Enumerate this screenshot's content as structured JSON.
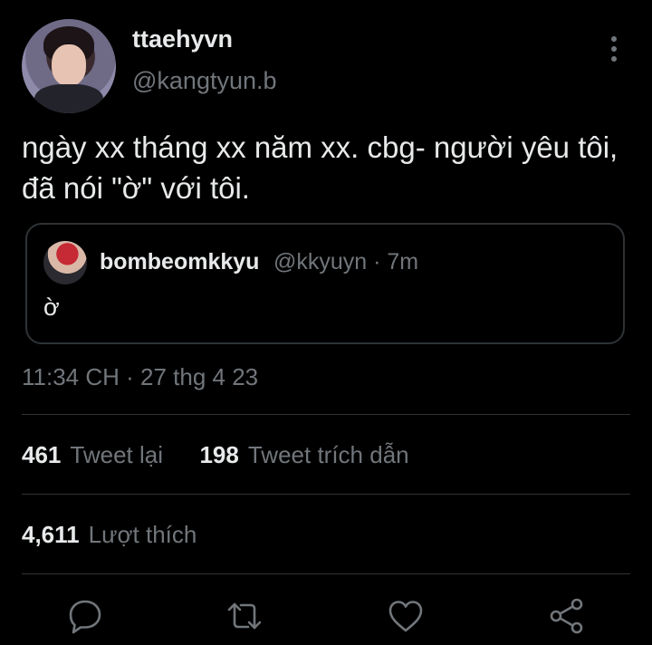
{
  "author": {
    "display_name": "ttaehyvn",
    "handle": "@kangtyun.b"
  },
  "tweet": {
    "text": "ngày xx tháng xx năm xx. cbg- người yêu tôi, đã nói \"ờ\" với tôi.",
    "timestamp": "11:34 CH · 27 thg 4 23"
  },
  "quoted_tweet": {
    "display_name": "bombeomkkyu",
    "handle_time": "@kkyuyn · 7m",
    "text": "ờ"
  },
  "stats": {
    "retweets_count": "461",
    "retweets_label": "Tweet lại",
    "quotes_count": "198",
    "quotes_label": "Tweet trích dẫn",
    "likes_count": "4,611",
    "likes_label": "Lượt thích"
  },
  "actions": [
    "reply-icon",
    "retweet-icon",
    "like-icon",
    "share-icon"
  ],
  "colors": {
    "background": "#000000",
    "primary_text": "#e7e9ea",
    "secondary_text": "#71767b",
    "border": "#2f3336"
  }
}
